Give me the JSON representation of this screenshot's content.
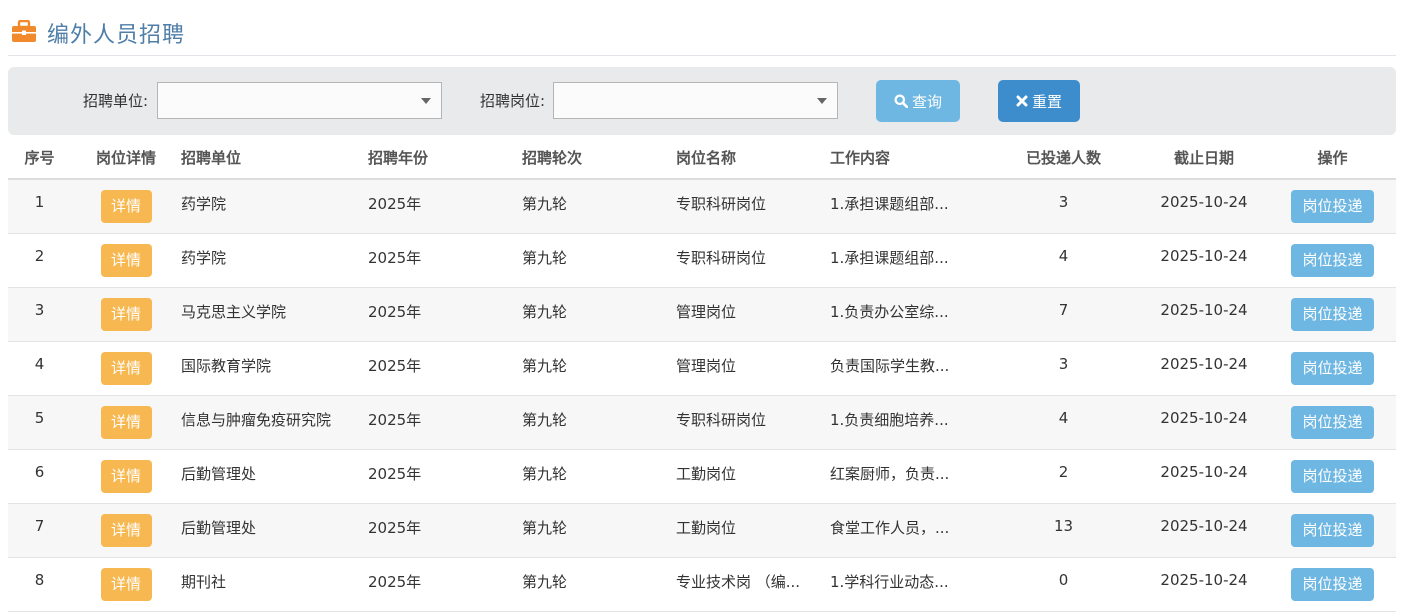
{
  "header": {
    "title": "编外人员招聘"
  },
  "filters": {
    "unit_label": "招聘单位:",
    "unit_value": "",
    "position_label": "招聘岗位:",
    "position_value": "",
    "query_label": "查询",
    "reset_label": "重置"
  },
  "table": {
    "columns": [
      "序号",
      "岗位详情",
      "招聘单位",
      "招聘年份",
      "招聘轮次",
      "岗位名称",
      "工作内容",
      "已投递人数",
      "截止日期",
      "操作"
    ],
    "rows": [
      {
        "no": "1",
        "detail": "详情",
        "unit": "药学院",
        "year": "2025年",
        "round": "第九轮",
        "position": "专职科研岗位",
        "content": "1.承担课题组部...",
        "applicants": "3",
        "deadline": "2025-10-24",
        "action": "岗位投递"
      },
      {
        "no": "2",
        "detail": "详情",
        "unit": "药学院",
        "year": "2025年",
        "round": "第九轮",
        "position": "专职科研岗位",
        "content": "1.承担课题组部...",
        "applicants": "4",
        "deadline": "2025-10-24",
        "action": "岗位投递"
      },
      {
        "no": "3",
        "detail": "详情",
        "unit": "马克思主义学院",
        "year": "2025年",
        "round": "第九轮",
        "position": "管理岗位",
        "content": "1.负责办公室综...",
        "applicants": "7",
        "deadline": "2025-10-24",
        "action": "岗位投递"
      },
      {
        "no": "4",
        "detail": "详情",
        "unit": "国际教育学院",
        "year": "2025年",
        "round": "第九轮",
        "position": "管理岗位",
        "content": "负责国际学生教...",
        "applicants": "3",
        "deadline": "2025-10-24",
        "action": "岗位投递"
      },
      {
        "no": "5",
        "detail": "详情",
        "unit": "信息与肿瘤免疫研究院",
        "year": "2025年",
        "round": "第九轮",
        "position": "专职科研岗位",
        "content": "1.负责细胞培养...",
        "applicants": "4",
        "deadline": "2025-10-24",
        "action": "岗位投递"
      },
      {
        "no": "6",
        "detail": "详情",
        "unit": "后勤管理处",
        "year": "2025年",
        "round": "第九轮",
        "position": "工勤岗位",
        "content": "红案厨师，负责...",
        "applicants": "2",
        "deadline": "2025-10-24",
        "action": "岗位投递"
      },
      {
        "no": "7",
        "detail": "详情",
        "unit": "后勤管理处",
        "year": "2025年",
        "round": "第九轮",
        "position": "工勤岗位",
        "content": "食堂工作人员，...",
        "applicants": "13",
        "deadline": "2025-10-24",
        "action": "岗位投递"
      },
      {
        "no": "8",
        "detail": "详情",
        "unit": "期刊社",
        "year": "2025年",
        "round": "第九轮",
        "position": "专业技术岗 （编...",
        "content": "1.学科行业动态...",
        "applicants": "0",
        "deadline": "2025-10-24",
        "action": "岗位投递"
      }
    ]
  },
  "colors": {
    "title": "#4f7ea8",
    "briefcase_icon": "#f08a2c",
    "detail_button": "#f7b851",
    "apply_button": "#6fb7e3",
    "query_button": "#6fb7e3",
    "reset_button": "#3d8dcd"
  },
  "icons": {
    "header": "briefcase-icon",
    "query": "search-icon",
    "reset": "close-icon",
    "select": "chevron-down-icon"
  }
}
